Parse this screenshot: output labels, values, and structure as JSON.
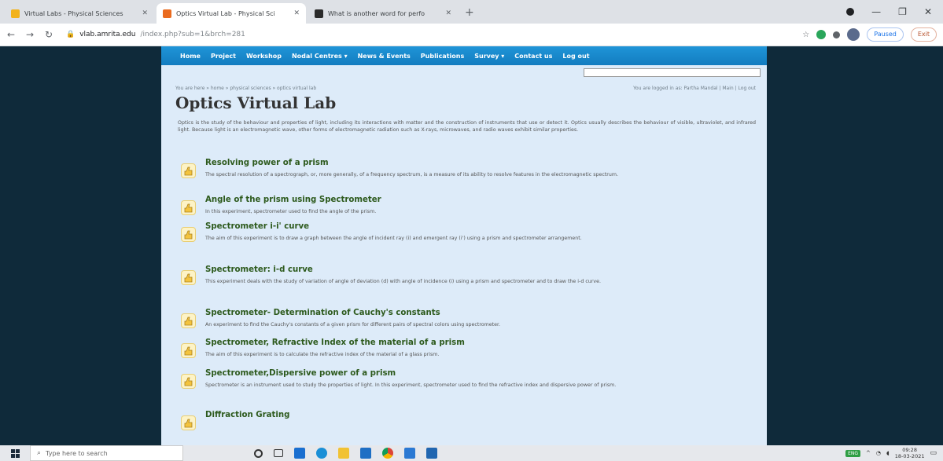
{
  "browser": {
    "tabs": [
      {
        "title": "Virtual Labs - Physical Sciences",
        "active": false,
        "favicon_color": "#f2b21a"
      },
      {
        "title": "Optics Virtual Lab - Physical Sci",
        "active": true,
        "favicon_color": "#ea6b1f"
      },
      {
        "title": "What is another word for perfo",
        "active": false,
        "favicon_color": "#2b2b2b"
      }
    ],
    "new_tab": "+",
    "window_controls": [
      "—",
      "❐",
      "✕"
    ],
    "url_host": "vlab.amrita.edu",
    "url_path": "/index.php?sub=1&brch=281",
    "paused_label": "Paused",
    "exit_label": "Exit"
  },
  "site": {
    "nav": [
      "Home",
      "Project",
      "Workshop",
      "Nodal Centres ▾",
      "News & Events",
      "Publications",
      "Survey ▾",
      "Contact us",
      "Log out"
    ],
    "breadcrumb": "You are here » home » physical sciences » optics virtual lab",
    "logged_in": "You are logged in as: Partha Mandal | Main | Log out",
    "title": "Optics Virtual Lab",
    "intro": "Optics is the study of the behaviour and properties of light, including its interactions with matter and the construction of instruments that use or detect it. Optics usually describes the behaviour of visible, ultraviolet, and infrared light. Because light is an electromagnetic wave, other forms of electromagnetic radiation such as X-rays, microwaves, and radio waves exhibit similar properties."
  },
  "experiments": [
    {
      "title": "Resolving power of a prism",
      "desc": "The spectral resolution of a spectrograph, or, more generally, of a frequency spectrum, is a measure of its ability to resolve features in the electromagnetic spectrum."
    },
    {
      "title": "Angle of the prism using Spectrometer",
      "desc": "In this experiment, spectrometer used to find the angle of the prism."
    },
    {
      "title": "Spectrometer i-i' curve",
      "desc": "The aim of this experiment is to draw a graph between the angle of incident ray (i) and emergent ray (i') using a prism and spectrometer arrangement."
    },
    {
      "title": "Spectrometer: i-d curve",
      "desc": "This experiment deals with the study of variation of angle of deviation (d) with angle of incidence (i) using a prism and spectrometer and to draw the i-d curve."
    },
    {
      "title": "Spectrometer- Determination of Cauchy's constants",
      "desc": "An experiment to find the Cauchy's constants of a given prism for different pairs of spectral colors using spectrometer."
    },
    {
      "title": "Spectrometer, Refractive Index of the material of a prism",
      "desc": "The aim of this experiment is to calculate the refractive index of the material of a glass prism."
    },
    {
      "title": "Spectrometer,Dispersive power of a prism",
      "desc": "Spectrometer is an instrument used to study the properties of light. In this experiment, spectrometer used to find the refractive index and dispersive power of prism."
    },
    {
      "title": "Diffraction Grating",
      "desc": ""
    }
  ],
  "taskbar": {
    "search_placeholder": "Type here to search",
    "battery_label": "ENG",
    "time": "09:28",
    "date": "18-03-2021"
  }
}
